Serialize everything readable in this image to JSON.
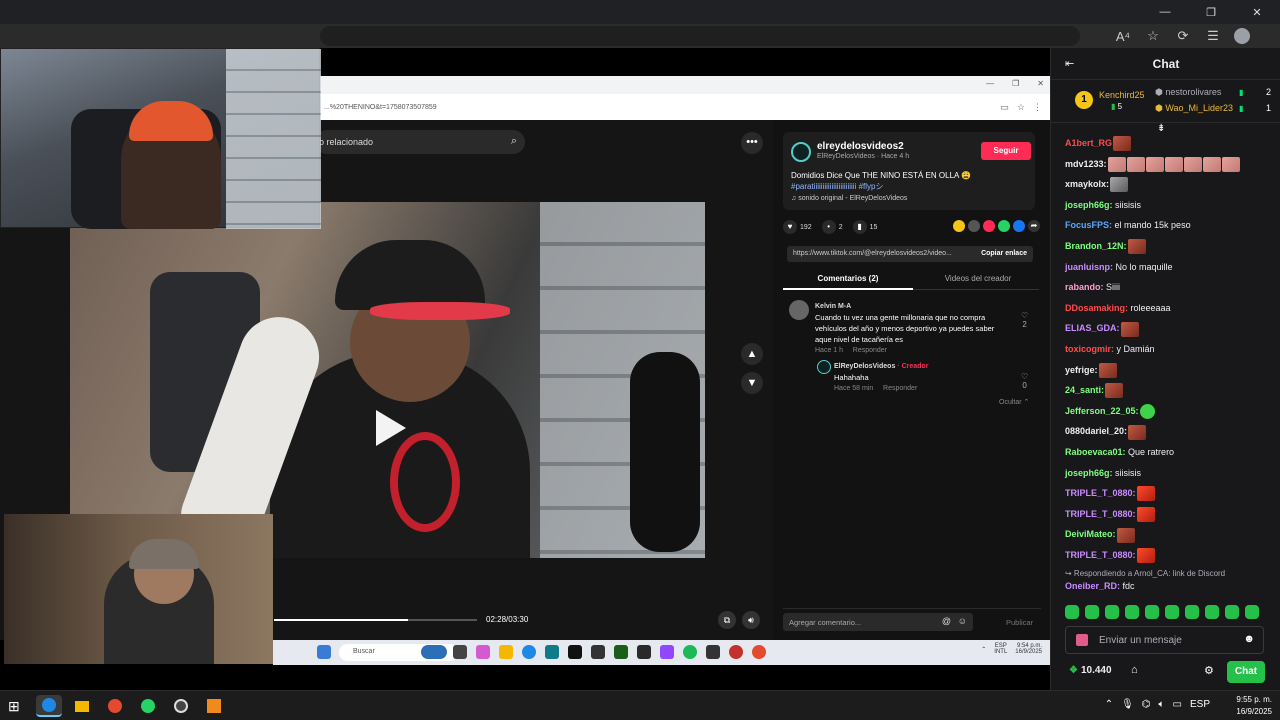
{
  "outer_browser": {
    "window_controls": [
      "—",
      "❐",
      "✕"
    ],
    "reader_label": "A⁴",
    "tools": [
      "☆",
      "⟳",
      "☰"
    ]
  },
  "inner_browser": {
    "url": "...%20THENINO&t=1758073507859",
    "search_placeholder": "o relacionado",
    "window_controls": [
      "—",
      "❐",
      "✕"
    ]
  },
  "tiktok": {
    "creator_handle": "elreydelosvideos2",
    "creator_meta": "ElReyDelosVideos · Hace 4 h",
    "follow_label": "Seguir",
    "description": "Domidios Dice Que THE NINO ESTÁ EN OLLA 😩",
    "hashtags": "#paratiiiiiiiiiiiiiiiiiiiiiiii #flypシ",
    "sound": "sonido original - ElReyDelosVideos",
    "likes": "192",
    "comments_count": "2",
    "saves": "15",
    "link": "https://www.tiktok.com/@elreydelosvideos2/video...",
    "copy_link_label": "Copiar enlace",
    "tabs": [
      "Comentarios (2)",
      "Videos del creador"
    ],
    "comments": [
      {
        "user": "Kelvin M-A",
        "text": "Cuando tu vez una gente millonaria que no compra vehículos del año y menos deportivo ya puedes saber aque nivel de tacañería es",
        "time": "Hace 1 h",
        "reply_label": "Responder",
        "likes": "2"
      },
      {
        "user": "ElReyDelosVideos",
        "creator_tag": "· Creador",
        "text": "Hahahaha",
        "time": "Hace 58 min",
        "reply_label": "Responder",
        "likes": "0"
      }
    ],
    "hide_label": "Ocultar",
    "add_comment_placeholder": "Agregar comentario...",
    "publish_label": "Publicar",
    "time": "02:28/03:30",
    "progress": 0.66
  },
  "inner_taskbar": {
    "search_label": "Buscar",
    "lang": "ESP\nINTL",
    "clock": "9:54 p.m.\n16/9/2025"
  },
  "chat": {
    "title": "Chat",
    "leaderboard": {
      "first_user": "Kenchird25",
      "first_count": "5",
      "first_rank": "1",
      "rows": [
        {
          "user": "nestorolivares",
          "count": "2",
          "color": "#adadb8"
        },
        {
          "user": "Wao_Mi_Lider23",
          "count": "1",
          "color": "#e8b93a"
        }
      ]
    },
    "messages": [
      {
        "user": "A1bert_RG",
        "color": "#ff4b4b",
        "text": "",
        "emotes": [
          "face"
        ]
      },
      {
        "user": "mdv1233:",
        "color": "#efeff1",
        "text": "",
        "emotes": [
          "pink",
          "pink",
          "pink",
          "pink",
          "pink",
          "pink",
          "pink"
        ]
      },
      {
        "user": "xmaykolx:",
        "color": "#efeff1",
        "text": "",
        "emotes": [
          "gray"
        ]
      },
      {
        "user": "joseph66g:",
        "color": "#7fff7f",
        "text": " siisisis",
        "emotes": []
      },
      {
        "user": "FocusFPS:",
        "color": "#5aa7ff",
        "text": " el mando 15k peso",
        "emotes": []
      },
      {
        "user": "Brandon_12N:",
        "color": "#7fff7f",
        "text": "",
        "emotes": [
          "face"
        ]
      },
      {
        "user": "juanluisnp:",
        "color": "#c98cff",
        "text": " No lo maquille",
        "emotes": []
      },
      {
        "user": "rabando:",
        "color": "#ff9fd0",
        "text": " Siiii",
        "emotes": []
      },
      {
        "user": "DDosamaking:",
        "color": "#ff4b4b",
        "text": " roleeeaaa",
        "emotes": []
      },
      {
        "user": "ELIAS_GDA:",
        "color": "#c98cff",
        "text": "",
        "emotes": [
          "face"
        ]
      },
      {
        "user": "toxicogmir:",
        "color": "#ff4b4b",
        "text": " y Damián",
        "emotes": []
      },
      {
        "user": "yefrige:",
        "color": "#efeff1",
        "text": "",
        "emotes": [
          "face"
        ]
      },
      {
        "user": "24_santi:",
        "color": "#7fff7f",
        "text": "",
        "emotes": [
          "face"
        ]
      },
      {
        "user": "Jefferson_22_05:",
        "color": "#7fff7f",
        "text": "",
        "emotes": [
          "green"
        ]
      },
      {
        "user": "0880dariel_20:",
        "color": "#efeff1",
        "text": "",
        "emotes": [
          "face"
        ]
      },
      {
        "user": "Raboevaca01:",
        "color": "#7fff7f",
        "text": " Que ratrero",
        "emotes": []
      },
      {
        "user": "joseph66g:",
        "color": "#7fff7f",
        "text": " siisisis",
        "emotes": []
      },
      {
        "user": "TRIPLE_T_0880:",
        "color": "#c98cff",
        "text": "",
        "emotes": [
          "red"
        ]
      },
      {
        "user": "TRIPLE_T_0880:",
        "color": "#c98cff",
        "text": "",
        "emotes": [
          "red"
        ]
      },
      {
        "user": "DeiviMateo:",
        "color": "#7fff7f",
        "text": "",
        "emotes": [
          "face"
        ]
      },
      {
        "user": "TRIPLE_T_0880:",
        "color": "#c98cff",
        "text": "",
        "emotes": [
          "red"
        ]
      }
    ],
    "reply_context": "↪ Respondiendo a Arnol_CA: link de Discord",
    "last_message": {
      "user": "Oneiber_RD:",
      "color": "#c98cff",
      "text": " fdc"
    },
    "input_placeholder": "Enviar un mensaje",
    "points": "10.440",
    "chat_button": "Chat"
  },
  "os": {
    "lang": "ESP",
    "time": "9:55 p. m.",
    "date": "16/9/2025"
  }
}
